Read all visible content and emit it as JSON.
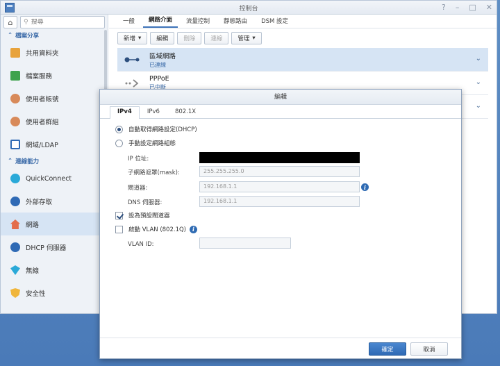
{
  "window": {
    "title": "控制台"
  },
  "sidebar": {
    "search_placeholder": "搜尋",
    "sections": [
      {
        "label": "檔案分享"
      },
      {
        "label": "連線能力"
      }
    ],
    "items": [
      {
        "label": "共用資料夾",
        "icon": "shared-folder-icon",
        "color": "#e8a33c"
      },
      {
        "label": "檔案服務",
        "icon": "file-services-icon",
        "color": "#3fa34d"
      },
      {
        "label": "使用者帳號",
        "icon": "user-icon",
        "color": "#d88a5a"
      },
      {
        "label": "使用者群組",
        "icon": "user-group-icon",
        "color": "#d88a5a"
      },
      {
        "label": "網域/LDAP",
        "icon": "domain-icon",
        "color": "#2f6ab5"
      },
      {
        "label": "QuickConnect",
        "icon": "quickconnect-icon",
        "color": "#2aa9d8"
      },
      {
        "label": "外部存取",
        "icon": "external-access-icon",
        "color": "#2f6ab5"
      },
      {
        "label": "網路",
        "icon": "network-icon",
        "color": "#e36d4b"
      },
      {
        "label": "DHCP 伺服器",
        "icon": "dhcp-icon",
        "color": "#2f6ab5"
      },
      {
        "label": "無線",
        "icon": "wireless-icon",
        "color": "#2aa9d8"
      },
      {
        "label": "安全性",
        "icon": "security-icon",
        "color": "#f0b63c"
      }
    ]
  },
  "tabs": [
    "一般",
    "網路介面",
    "流量控制",
    "靜態路由",
    "DSM 設定"
  ],
  "toolbar": {
    "create": "新增",
    "edit": "編輯",
    "delete": "刪除",
    "connect": "連線",
    "manage": "管理"
  },
  "network_items": [
    {
      "name": "區域網路",
      "status": "已連線"
    },
    {
      "name": "PPPoE",
      "status": "已中斷"
    }
  ],
  "dialog": {
    "title": "編輯",
    "tabs": [
      "IPv4",
      "IPv6",
      "802.1X"
    ],
    "dhcp_option": "自動取得網路設定(DHCP)",
    "manual_option": "手動設定網路組態",
    "ip_label": "IP 位址:",
    "mask_label": "子網路遮罩(mask):",
    "mask_value": "255.255.255.0",
    "gateway_label": "閘道器:",
    "gateway_value": "192.168.1.1",
    "dns_label": "DNS 伺服器:",
    "dns_value": "192.168.1.1",
    "default_gateway_label": "設為預設閘道器",
    "vlan_label": "啟動 VLAN (802.1Q)",
    "vlan_id_label": "VLAN ID:",
    "ok": "確定",
    "cancel": "取消"
  }
}
